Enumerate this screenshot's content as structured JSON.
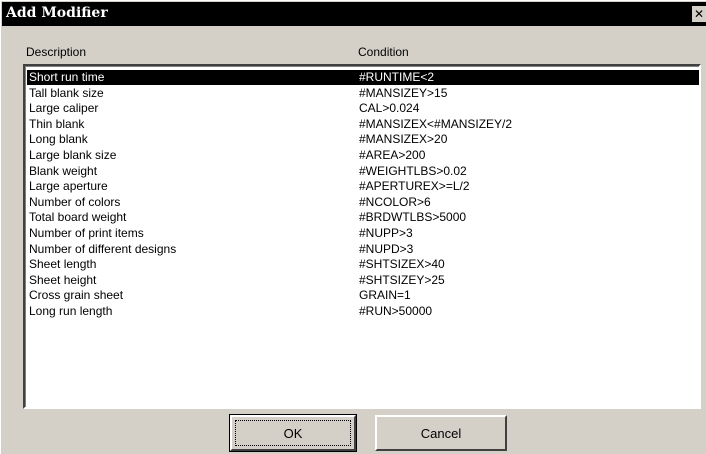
{
  "window": {
    "title": "Add Modifier",
    "close_glyph": "✕"
  },
  "columns": {
    "description": "Description",
    "condition": "Condition"
  },
  "modifiers": [
    {
      "description": "Short run time",
      "condition": "#RUNTIME<2",
      "selected": true
    },
    {
      "description": "Tall blank size",
      "condition": "#MANSIZEY>15"
    },
    {
      "description": "Large caliper",
      "condition": "CAL>0.024"
    },
    {
      "description": "Thin blank",
      "condition": "#MANSIZEX<#MANSIZEY/2"
    },
    {
      "description": "Long blank",
      "condition": "#MANSIZEX>20"
    },
    {
      "description": "Large blank size",
      "condition": "#AREA>200"
    },
    {
      "description": "Blank weight",
      "condition": "#WEIGHTLBS>0.02"
    },
    {
      "description": "Large aperture",
      "condition": "#APERTUREX>=L/2"
    },
    {
      "description": "Number of colors",
      "condition": "#NCOLOR>6"
    },
    {
      "description": "Total board weight",
      "condition": "#BRDWTLBS>5000"
    },
    {
      "description": "Number of print items",
      "condition": "#NUPP>3"
    },
    {
      "description": "Number of different designs",
      "condition": "#NUPD>3"
    },
    {
      "description": "Sheet length",
      "condition": "#SHTSIZEX>40"
    },
    {
      "description": "Sheet height",
      "condition": "#SHTSIZEY>25"
    },
    {
      "description": "Cross grain sheet",
      "condition": "GRAIN=1"
    },
    {
      "description": "Long run length",
      "condition": "#RUN>50000"
    }
  ],
  "buttons": {
    "ok": "OK",
    "cancel": "Cancel"
  },
  "colors": {
    "dialog_face": "#d4d0c8",
    "titlebar": "#000000",
    "selection": "#000000"
  }
}
